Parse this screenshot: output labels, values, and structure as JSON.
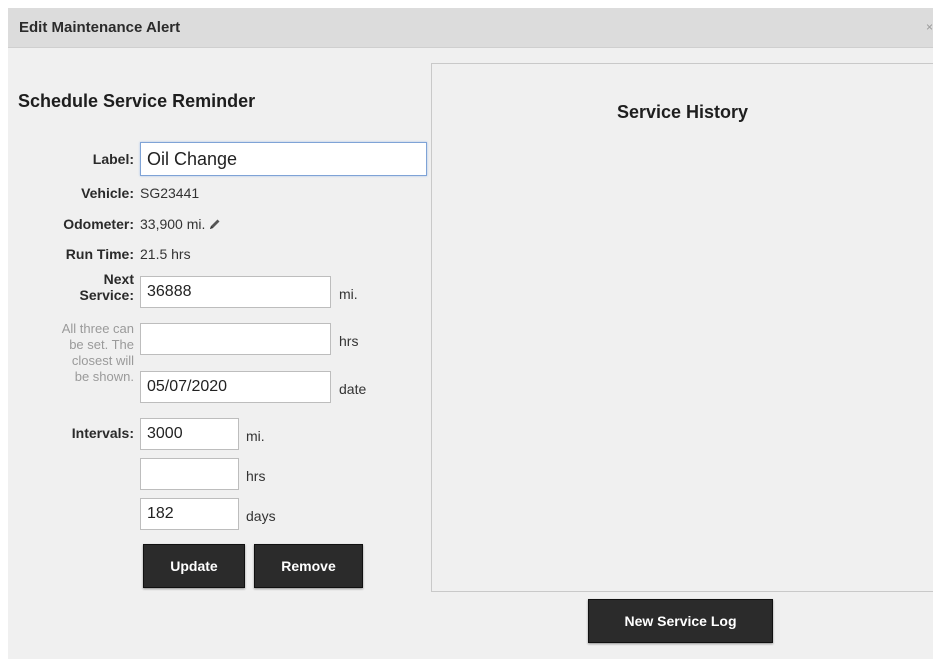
{
  "dialog": {
    "title": "Edit Maintenance Alert",
    "close_glyph": "×"
  },
  "reminder": {
    "heading": "Schedule Service Reminder",
    "label_label": "Label:",
    "label_value": "Oil Change",
    "vehicle_label": "Vehicle:",
    "vehicle_value": "SG23441",
    "odometer_label": "Odometer:",
    "odometer_value": "33,900 mi.",
    "odometer_icon": "pencil-icon",
    "runtime_label": "Run Time:",
    "runtime_value": "21.5 hrs",
    "next_service_label_line1": "Next",
    "next_service_label_line2": "Service:",
    "note_lines": [
      "All three can",
      "be set. The",
      "closest will",
      "be shown."
    ],
    "next_service": {
      "miles_value": "36888",
      "miles_unit": "mi.",
      "hours_value": "",
      "hours_unit": "hrs",
      "date_value": "05/07/2020",
      "date_unit": "date"
    },
    "intervals_label": "Intervals:",
    "intervals": {
      "miles_value": "3000",
      "miles_unit": "mi.",
      "hours_value": "",
      "hours_unit": "hrs",
      "days_value": "182",
      "days_unit": "days"
    },
    "update_label": "Update",
    "remove_label": "Remove"
  },
  "history": {
    "heading": "Service History",
    "new_log_label": "New Service Log"
  },
  "colors": {
    "dialog_bg": "#f0f0f0",
    "titlebar_bg": "#dcdcdc",
    "button_bg": "#2b2b2b",
    "focus_border": "#7fa3d6",
    "note_text": "#9a9a9a"
  }
}
